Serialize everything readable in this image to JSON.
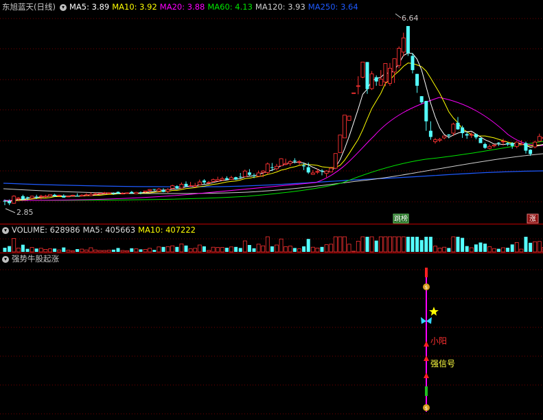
{
  "main_panel": {
    "title": "东旭蓝天(日线)",
    "ma_labels": [
      {
        "label": "MA5: 3.89",
        "color": "#ffffff"
      },
      {
        "label": "MA10: 3.92",
        "color": "#ffff00"
      },
      {
        "label": "MA20: 3.88",
        "color": "#ff00ff"
      },
      {
        "label": "MA60: 4.13",
        "color": "#00e600"
      },
      {
        "label": "MA120: 3.93",
        "color": "#d0d0d0"
      },
      {
        "label": "MA250: 3.64",
        "color": "#1e5aff"
      }
    ],
    "high_label": "6.64",
    "low_label": "2.85",
    "badge_left": "跳榜",
    "badge_right": "涨"
  },
  "volume_panel": {
    "items": [
      {
        "label": "VOLUME: 628986",
        "color": "#dcdcdc"
      },
      {
        "label": "MA5: 405663",
        "color": "#dcdcdc"
      },
      {
        "label": "MA10: 407222",
        "color": "#ffff00"
      }
    ]
  },
  "indicator_panel": {
    "title": "强势牛股起涨",
    "label_small_yang": "小阳",
    "label_strong_signal": "强信号",
    "star_icon": "star-icon",
    "butterfly_icon": "butterfly-icon",
    "money_bag_icon": "money-bag-icon"
  },
  "colors": {
    "up": "#ff3232",
    "down": "#54ffff",
    "grid": "#8b0000",
    "ma5": "#ffffff",
    "ma10": "#ffff00",
    "ma20": "#ff00ff",
    "ma60": "#00e600",
    "ma120": "#d0d0d0",
    "ma250": "#1e5aff"
  },
  "chart_data": {
    "type": "candlestick",
    "y_range": [
      2.7,
      6.9
    ],
    "candles": [
      [
        2.95,
        2.98,
        2.86,
        2.94
      ],
      [
        2.94,
        2.98,
        2.86,
        2.9
      ],
      [
        2.9,
        3.07,
        2.89,
        3.05
      ],
      [
        2.99,
        3.03,
        2.94,
        3.01
      ],
      [
        3.05,
        3.08,
        2.97,
        2.98
      ],
      [
        3.03,
        3.04,
        2.96,
        3.02
      ],
      [
        3.01,
        3.06,
        2.99,
        3.05
      ],
      [
        3.04,
        3.08,
        2.99,
        3.03
      ],
      [
        3.04,
        3.08,
        2.98,
        3.05
      ],
      [
        3.04,
        3.08,
        3.02,
        3.05
      ],
      [
        3.05,
        3.08,
        3.04,
        3.08
      ],
      [
        3.08,
        3.1,
        3.05,
        3.05
      ],
      [
        3.06,
        3.08,
        3.04,
        3.07
      ],
      [
        3.06,
        3.09,
        3.02,
        3.02
      ],
      [
        3.04,
        3.06,
        3.03,
        3.05
      ],
      [
        3.07,
        3.08,
        3.05,
        3.07
      ],
      [
        3.06,
        3.11,
        3.04,
        3.05
      ],
      [
        3.05,
        3.09,
        3.04,
        3.07
      ],
      [
        3.08,
        3.11,
        3.05,
        3.08
      ],
      [
        3.06,
        3.13,
        3.05,
        3.09
      ],
      [
        3.09,
        3.13,
        3.09,
        3.1
      ],
      [
        3.1,
        3.11,
        3.09,
        3.11
      ],
      [
        3.12,
        3.14,
        3.1,
        3.12
      ],
      [
        3.11,
        3.13,
        3.1,
        3.12
      ],
      [
        3.11,
        3.13,
        3.08,
        3.1
      ],
      [
        3.14,
        3.15,
        3.1,
        3.1
      ],
      [
        3.11,
        3.13,
        3.09,
        3.11
      ],
      [
        3.12,
        3.13,
        3.1,
        3.12
      ],
      [
        3.14,
        3.16,
        3.1,
        3.11
      ],
      [
        3.1,
        3.14,
        3.1,
        3.13
      ],
      [
        3.13,
        3.15,
        3.09,
        3.12
      ],
      [
        3.14,
        3.16,
        3.12,
        3.16
      ],
      [
        3.17,
        3.2,
        3.12,
        3.19
      ],
      [
        3.2,
        3.2,
        3.16,
        3.19
      ],
      [
        3.16,
        3.22,
        3.13,
        3.2
      ],
      [
        3.18,
        3.22,
        3.13,
        3.14
      ],
      [
        3.15,
        3.22,
        3.12,
        3.19
      ],
      [
        3.21,
        3.29,
        3.2,
        3.27
      ],
      [
        3.26,
        3.28,
        3.19,
        3.22
      ],
      [
        3.22,
        3.34,
        3.22,
        3.3
      ],
      [
        3.31,
        3.36,
        3.24,
        3.26
      ],
      [
        3.27,
        3.35,
        3.25,
        3.27
      ],
      [
        3.25,
        3.33,
        3.25,
        3.27
      ],
      [
        3.29,
        3.4,
        3.28,
        3.35
      ],
      [
        3.38,
        3.41,
        3.3,
        3.34
      ],
      [
        3.34,
        3.37,
        3.33,
        3.34
      ],
      [
        3.36,
        3.42,
        3.34,
        3.4
      ],
      [
        3.37,
        3.46,
        3.37,
        3.4
      ],
      [
        3.39,
        3.46,
        3.37,
        3.42
      ],
      [
        3.43,
        3.47,
        3.39,
        3.4
      ],
      [
        3.4,
        3.48,
        3.39,
        3.44
      ],
      [
        3.45,
        3.46,
        3.39,
        3.4
      ],
      [
        3.46,
        3.54,
        3.43,
        3.45
      ],
      [
        3.46,
        3.61,
        3.46,
        3.58
      ],
      [
        3.55,
        3.62,
        3.48,
        3.5
      ],
      [
        3.49,
        3.53,
        3.43,
        3.48
      ],
      [
        3.47,
        3.59,
        3.46,
        3.54
      ],
      [
        3.55,
        3.6,
        3.45,
        3.58
      ],
      [
        3.55,
        3.76,
        3.51,
        3.73
      ],
      [
        3.66,
        3.75,
        3.58,
        3.65
      ],
      [
        3.63,
        3.73,
        3.59,
        3.68
      ],
      [
        3.69,
        3.85,
        3.69,
        3.84
      ],
      [
        3.72,
        3.84,
        3.7,
        3.74
      ],
      [
        3.74,
        3.81,
        3.69,
        3.78
      ],
      [
        3.8,
        3.85,
        3.74,
        3.79
      ],
      [
        3.78,
        3.81,
        3.71,
        3.78
      ],
      [
        3.7,
        3.75,
        3.6,
        3.68
      ],
      [
        3.66,
        3.76,
        3.52,
        3.55
      ],
      [
        3.51,
        3.6,
        3.5,
        3.54
      ],
      [
        3.56,
        3.63,
        3.52,
        3.57
      ],
      [
        3.59,
        3.62,
        3.49,
        3.57
      ],
      [
        3.53,
        3.6,
        3.45,
        3.58
      ],
      [
        3.56,
        3.67,
        3.56,
        3.64
      ],
      [
        3.64,
        3.95,
        3.62,
        3.95
      ],
      [
        3.97,
        4.34,
        3.97,
        4.34
      ],
      [
        4.28,
        4.76,
        4.28,
        4.76
      ],
      [
        4.65,
        4.74,
        4.65,
        4.74
      ],
      [
        5.23,
        5.23,
        5.23,
        5.23
      ],
      [
        5.38,
        5.58,
        5.2,
        5.38
      ],
      [
        5.56,
        5.88,
        5.54,
        5.88
      ],
      [
        5.88,
        5.88,
        5.21,
        5.31
      ],
      [
        5.32,
        5.69,
        5.29,
        5.63
      ],
      [
        5.56,
        5.6,
        5.38,
        5.47
      ],
      [
        5.39,
        5.71,
        5.39,
        5.52
      ],
      [
        5.46,
        5.85,
        5.37,
        5.85
      ],
      [
        5.43,
        5.86,
        5.38,
        5.75
      ],
      [
        5.67,
        5.95,
        5.44,
        5.95
      ],
      [
        5.81,
        6.21,
        5.75,
        6.17
      ],
      [
        6.09,
        6.5,
        6.0,
        6.39
      ],
      [
        6.64,
        6.64,
        6.01,
        6.07
      ],
      [
        6.01,
        6.07,
        5.64,
        5.71
      ],
      [
        5.63,
        5.63,
        5.23,
        5.38
      ],
      [
        5.16,
        5.16,
        5.0,
        5.03
      ],
      [
        5.06,
        5.06,
        4.43,
        4.63
      ],
      [
        4.43,
        4.63,
        4.24,
        4.3
      ],
      [
        4.2,
        4.28,
        4.16,
        4.24
      ],
      [
        4.23,
        4.28,
        4.19,
        4.25
      ],
      [
        4.28,
        4.33,
        4.25,
        4.32
      ],
      [
        4.35,
        4.36,
        4.27,
        4.33
      ],
      [
        4.38,
        4.6,
        4.32,
        4.57
      ],
      [
        4.6,
        4.72,
        4.45,
        4.46
      ],
      [
        4.5,
        4.54,
        4.28,
        4.38
      ],
      [
        4.36,
        4.4,
        4.26,
        4.33
      ],
      [
        4.34,
        4.4,
        4.28,
        4.35
      ],
      [
        4.36,
        4.37,
        4.25,
        4.29
      ],
      [
        4.28,
        4.28,
        4.17,
        4.17
      ],
      [
        4.15,
        4.18,
        4.05,
        4.07
      ],
      [
        4.06,
        4.14,
        4.04,
        4.1
      ],
      [
        4.11,
        4.15,
        4.08,
        4.13
      ],
      [
        4.18,
        4.19,
        4.11,
        4.17
      ],
      [
        4.21,
        4.26,
        4.12,
        4.21
      ],
      [
        4.17,
        4.19,
        4.11,
        4.14
      ],
      [
        4.17,
        4.19,
        4.05,
        4.11
      ],
      [
        4.1,
        4.21,
        4.06,
        4.19
      ],
      [
        4.15,
        4.23,
        4.14,
        4.15
      ],
      [
        4.17,
        4.2,
        3.95,
        4.01
      ],
      [
        4.03,
        4.04,
        3.9,
        3.94
      ],
      [
        4.09,
        4.22,
        4.06,
        4.19
      ],
      [
        4.21,
        4.37,
        4.2,
        4.31
      ],
      [
        4.27,
        4.32,
        4.21,
        4.29
      ]
    ],
    "ma5": [
      2.95,
      2.94,
      2.96,
      2.98,
      2.98,
      3.0,
      3.02,
      3.02,
      3.03,
      3.04,
      3.05,
      3.05,
      3.06,
      3.05,
      3.05,
      3.05,
      3.05,
      3.05,
      3.07,
      3.07,
      3.08,
      3.09,
      3.1,
      3.11,
      3.11,
      3.11,
      3.11,
      3.11,
      3.11,
      3.11,
      3.12,
      3.13,
      3.14,
      3.15,
      3.17,
      3.18,
      3.18,
      3.2,
      3.2,
      3.22,
      3.25,
      3.26,
      3.26,
      3.29,
      3.3,
      3.31,
      3.34,
      3.36,
      3.38,
      3.39,
      3.41,
      3.41,
      3.42,
      3.46,
      3.47,
      3.48,
      3.51,
      3.54,
      3.57,
      3.6,
      3.64,
      3.69,
      3.73,
      3.76,
      3.77,
      3.76,
      3.75,
      3.71,
      3.66,
      3.62,
      3.57,
      3.56,
      3.58,
      3.66,
      3.82,
      4.05,
      4.31,
      4.6,
      4.89,
      5.2,
      5.31,
      5.49,
      5.53,
      5.56,
      5.65,
      5.64,
      5.71,
      5.85,
      6.02,
      6.07,
      6.06,
      5.94,
      5.71,
      5.36,
      5.01,
      4.72,
      4.49,
      4.35,
      4.29,
      4.34,
      4.38,
      4.41,
      4.41,
      4.42,
      4.36,
      4.3,
      4.24,
      4.2,
      4.15,
      4.15,
      4.14,
      4.15,
      4.15,
      4.17,
      4.16,
      4.12,
      4.08,
      4.1,
      4.12,
      4.15
    ],
    "ma10": [
      2.95,
      2.94,
      2.96,
      2.96,
      2.97,
      2.98,
      2.99,
      3.0,
      3.01,
      3.01,
      3.02,
      3.04,
      3.04,
      3.04,
      3.05,
      3.05,
      3.05,
      3.05,
      3.06,
      3.06,
      3.07,
      3.07,
      3.08,
      3.09,
      3.09,
      3.1,
      3.1,
      3.11,
      3.11,
      3.11,
      3.11,
      3.12,
      3.12,
      3.13,
      3.14,
      3.15,
      3.15,
      3.17,
      3.17,
      3.19,
      3.21,
      3.22,
      3.23,
      3.25,
      3.26,
      3.28,
      3.3,
      3.31,
      3.33,
      3.35,
      3.36,
      3.37,
      3.39,
      3.42,
      3.43,
      3.45,
      3.46,
      3.48,
      3.51,
      3.53,
      3.56,
      3.6,
      3.62,
      3.65,
      3.67,
      3.7,
      3.72,
      3.72,
      3.71,
      3.7,
      3.67,
      3.66,
      3.65,
      3.66,
      3.7,
      3.81,
      3.95,
      4.1,
      4.25,
      4.45,
      4.68,
      4.9,
      5.06,
      5.22,
      5.43,
      5.5,
      5.61,
      5.69,
      5.79,
      5.86,
      5.85,
      5.82,
      5.78,
      5.69,
      5.54,
      5.38,
      5.22,
      5.03,
      4.83,
      4.7,
      4.6,
      4.47,
      4.41,
      4.35,
      4.32,
      4.32,
      4.32,
      4.3,
      4.28,
      4.25,
      4.22,
      4.19,
      4.17,
      4.16,
      4.15,
      4.13,
      4.11,
      4.13,
      4.13,
      4.14
    ]
  }
}
